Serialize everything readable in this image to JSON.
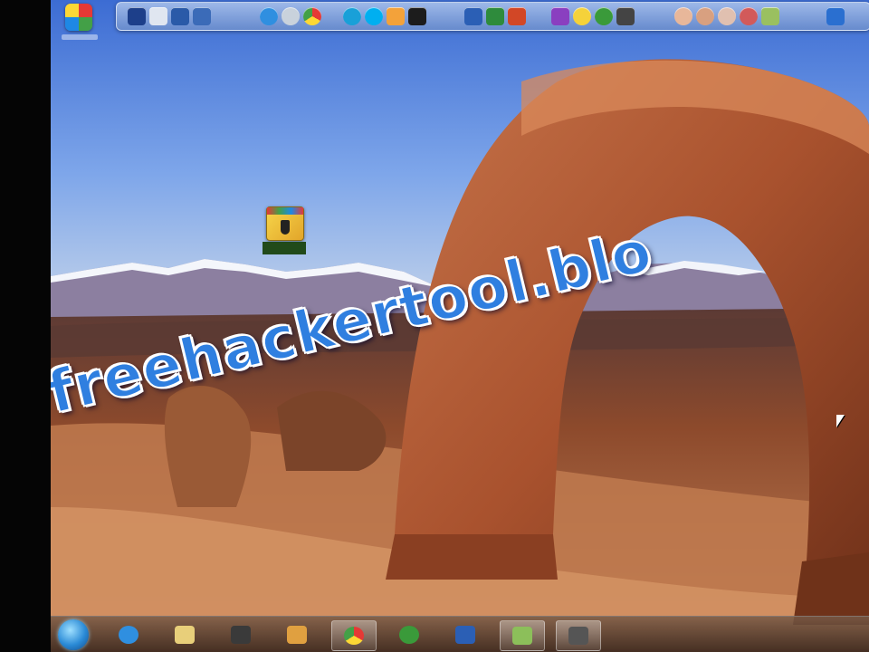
{
  "watermark": {
    "text": "freehackertool.blo"
  },
  "desktop_icons": [
    {
      "name": "desktop-shortcut-top-left"
    },
    {
      "name": "hack-tool-app-icon"
    }
  ],
  "top_dock": {
    "icons": [
      "user-icon",
      "folder-icon",
      "network-icon",
      "media-icon",
      "internet-explorer-icon",
      "globe-icon",
      "chrome-icon",
      "connection-icon",
      "skype-icon",
      "media-player-icon",
      "play-icon",
      "word-icon",
      "excel-icon",
      "powerpoint-icon",
      "messenger-icon",
      "smiley-icon",
      "utorrent-icon",
      "camera-icon",
      "avatar-1-icon",
      "avatar-2-icon",
      "avatar-3-icon",
      "avatar-4-icon",
      "photo-icon",
      "photoshop-icon"
    ]
  },
  "taskbar": {
    "items": [
      "internet-explorer-icon",
      "folder-icon",
      "camera-icon",
      "media-player-icon",
      "chrome-icon",
      "utorrent-icon",
      "word-icon",
      "image-viewer-icon",
      "app-icon"
    ]
  },
  "colors": {
    "watermark_fill": "#2f7fe0",
    "watermark_stroke": "#ffffff",
    "sky": "#4f7fdc",
    "rock": "#b5613a"
  }
}
